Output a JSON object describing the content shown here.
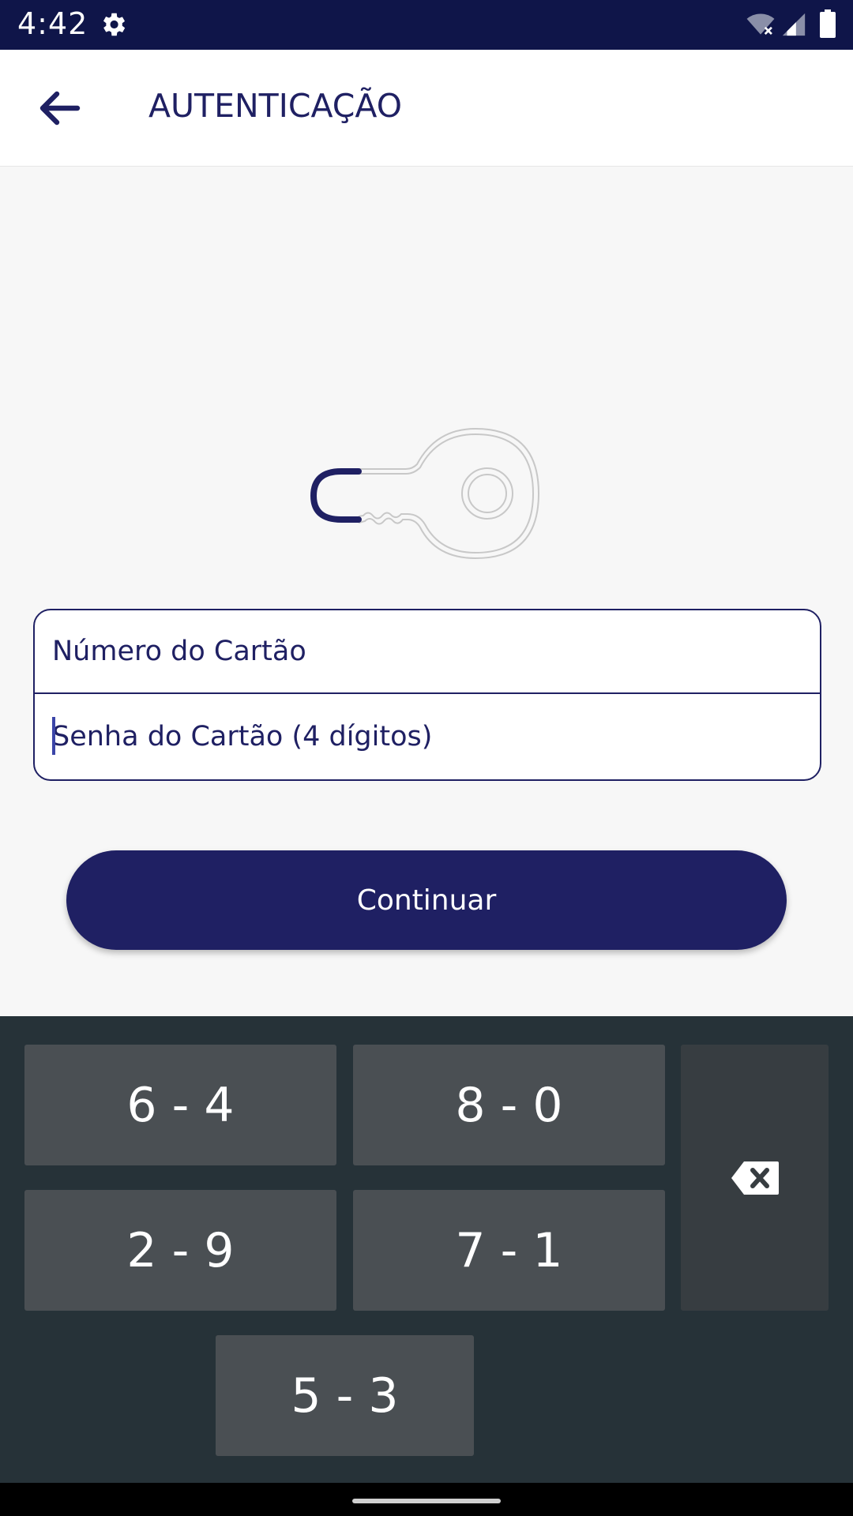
{
  "status_bar": {
    "time": "4:42",
    "icons": [
      "settings-gear-icon",
      "wifi-off-icon",
      "cell-signal-icon",
      "battery-icon"
    ]
  },
  "app_bar": {
    "back_icon": "arrow-left-icon",
    "title": "AUTENTICAÇÃO"
  },
  "illustration": {
    "icon": "key-icon"
  },
  "form": {
    "card_number_placeholder": "Número do Cartão",
    "card_password_placeholder": "Senha do Cartão (4 dígitos)"
  },
  "continue_button": {
    "label": "Continuar"
  },
  "keypad": {
    "keys": [
      "6 - 4",
      "8 - 0",
      "2 - 9",
      "7 - 1",
      "5 - 3"
    ],
    "delete_icon": "backspace-icon"
  },
  "colors": {
    "primary": "#1f2063",
    "status_bar": "#0f1549",
    "keypad_bg": "#263238",
    "key_bg": "#4a4f53"
  }
}
